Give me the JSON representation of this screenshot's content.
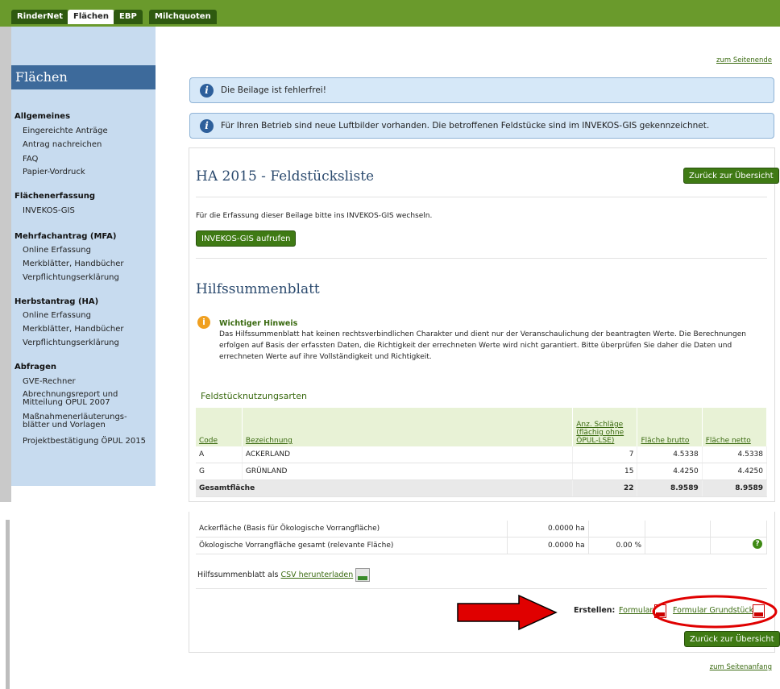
{
  "tabs": [
    "RinderNet",
    "Flächen",
    "EBP",
    "Milchquoten"
  ],
  "active_tab": 1,
  "sidebar": {
    "title": "Flächen",
    "groups": [
      {
        "label": "Allgemeines",
        "items": [
          "Eingereichte Anträge",
          "Antrag nachreichen",
          "FAQ",
          "Papier-Vordruck"
        ]
      },
      {
        "label": "Flächenerfassung",
        "items": [
          "INVEKOS-GIS"
        ]
      },
      {
        "label": "Mehrfachantrag (MFA)",
        "items": [
          "Online Erfassung",
          "Merkblätter, Handbücher",
          "Verpflichtungserklärung"
        ]
      },
      {
        "label": "Herbstantrag (HA)",
        "items": [
          "Online Erfassung",
          "Merkblätter, Handbücher",
          "Verpflichtungserklärung"
        ]
      },
      {
        "label": "Abfragen",
        "items": [
          "GVE-Rechner",
          "Abrechnungsreport und Mitteilung ÖPUL 2007",
          "Maßnahmenerläuterungs-blätter und Vorlagen",
          "Projektbestätigung ÖPUL 2015"
        ]
      }
    ]
  },
  "links": {
    "to_end": "zum Seitenende",
    "to_top": "zum Seitenanfang"
  },
  "messages": [
    "Die Beilage ist fehlerfrei!",
    "Für Ihren Betrieb sind neue Luftbilder vorhanden. Die betroffenen Feldstücke sind im INVEKOS-GIS gekennzeichnet."
  ],
  "main": {
    "title": "HA 2015 - Feldstücksliste",
    "back_button": "Zurück zur Übersicht",
    "gis_text": "Für die Erfassung dieser Beilage bitte ins INVEKOS-GIS wechseln.",
    "gis_button": "INVEKOS-GIS aufrufen",
    "section_title": "Hilfssummenblatt",
    "notice_title": "Wichtiger Hinweis",
    "notice_text": "Das Hilfssummenblatt hat keinen rechtsverbindlichen Charakter und dient nur der Veranschaulichung der beantragten Werte. Die Berechnungen erfolgen auf Basis der erfassten Daten, die Richtigkeit der errechneten Werte wird nicht garantiert. Bitte überprüfen Sie daher die Daten und errechneten Werte auf ihre Vollständigkeit und Richtigkeit.",
    "table_title": "Feldstücknutzungsarten",
    "table": {
      "headers": [
        "Code",
        "Bezeichnung",
        "Anz. Schläge (flächig ohne ÖPUL-LSE)",
        "Fläche brutto",
        "Fläche netto"
      ],
      "rows": [
        [
          "A",
          "ACKERLAND",
          "7",
          "4.5338",
          "4.5338"
        ],
        [
          "G",
          "GRÜNLAND",
          "15",
          "4.4250",
          "4.4250"
        ]
      ],
      "total": [
        "Gesamtfläche",
        "",
        "22",
        "8.9589",
        "8.9589"
      ]
    },
    "table2": [
      [
        "Ackerfläche (Basis für Ökologische Vorrangfläche)",
        "0.0000 ha",
        "",
        ""
      ],
      [
        "Ökologische Vorrangfläche gesamt (relevante Fläche)",
        "0.0000 ha",
        "0.00 %",
        ""
      ]
    ],
    "csv_prefix": "Hilfssummenblatt als",
    "csv_link": "CSV herunterladen",
    "create_label": "Erstellen:",
    "create_links": [
      "Formular",
      "Formular Grundstücke"
    ]
  },
  "colors": {
    "nav": "#6a9a2c",
    "sidebar": "#c7dbef",
    "accent": "#3f7a14",
    "annotation": "#e00000"
  }
}
